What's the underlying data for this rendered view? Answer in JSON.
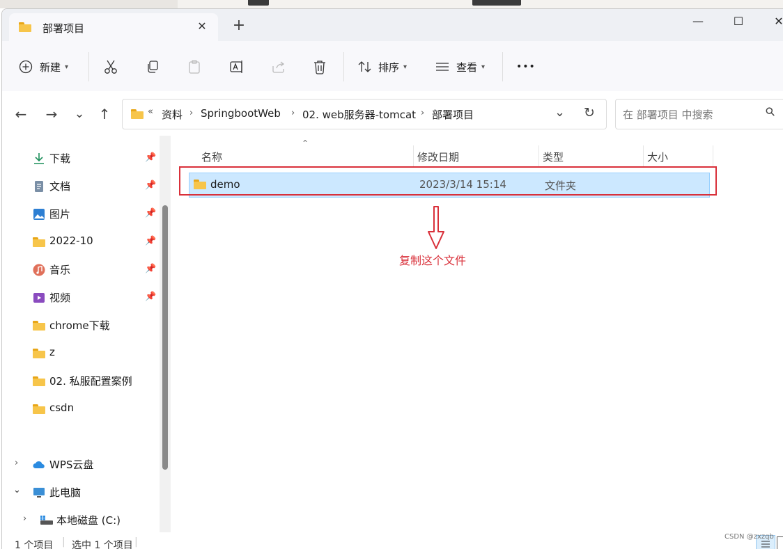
{
  "window": {
    "tab_title": "部署项目",
    "tab_close": "✕",
    "new_tab": "+",
    "min": "—",
    "max": "☐",
    "close": "✕"
  },
  "toolbar": {
    "new_label": "新建",
    "sort_label": "排序",
    "view_label": "查看",
    "more": "•••"
  },
  "nav": {
    "back": "←",
    "forward": "→",
    "recent": "⌄",
    "up": "↑",
    "refresh": "↻"
  },
  "address": {
    "overflow": "«",
    "crumbs": [
      "资料",
      "SpringbootWeb",
      "02. web服务器-tomcat",
      "部署项目"
    ],
    "sep": "›",
    "dropdown": "⌄"
  },
  "search": {
    "placeholder": "在 部署项目 中搜索",
    "icon": "⚲"
  },
  "sidebar": {
    "items": [
      {
        "label": "下载",
        "icon": "download-icon"
      },
      {
        "label": "文档",
        "icon": "document-icon"
      },
      {
        "label": "图片",
        "icon": "pictures-icon"
      },
      {
        "label": "2022-10",
        "icon": "folder-icon"
      },
      {
        "label": "音乐",
        "icon": "music-icon"
      },
      {
        "label": "视频",
        "icon": "video-icon"
      },
      {
        "label": "chrome下载",
        "icon": "folder-icon"
      },
      {
        "label": "z",
        "icon": "folder-icon"
      },
      {
        "label": "02. 私服配置案例",
        "icon": "folder-icon"
      },
      {
        "label": "csdn",
        "icon": "folder-icon"
      }
    ],
    "wps": "WPS云盘",
    "this_pc": "此电脑",
    "local_disk": "本地磁盘 (C:)"
  },
  "columns": {
    "name": "名称",
    "date": "修改日期",
    "type": "类型",
    "size": "大小"
  },
  "files": [
    {
      "name": "demo",
      "date": "2023/3/14 15:14",
      "type": "文件夹"
    }
  ],
  "annotation": "复制这个文件",
  "status": {
    "count": "1 个项目",
    "selected": "选中 1 个项目"
  },
  "watermark": "CSDN @zxzqb"
}
